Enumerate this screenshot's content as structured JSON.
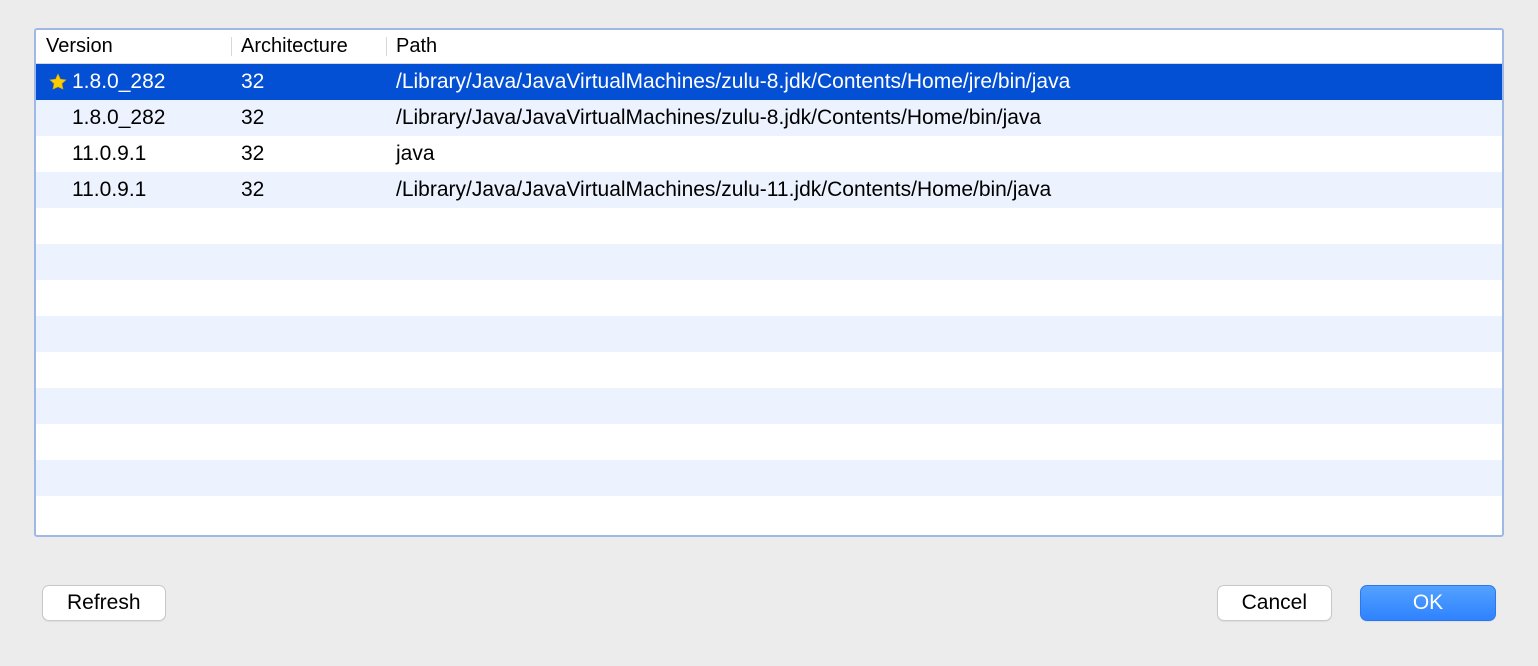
{
  "columns": {
    "version": "Version",
    "architecture": "Architecture",
    "path": "Path"
  },
  "rows": [
    {
      "starred": true,
      "version": "1.8.0_282",
      "arch": "32",
      "path": "/Library/Java/JavaVirtualMachines/zulu-8.jdk/Contents/Home/jre/bin/java",
      "selected": true
    },
    {
      "starred": false,
      "version": "1.8.0_282",
      "arch": "32",
      "path": "/Library/Java/JavaVirtualMachines/zulu-8.jdk/Contents/Home/bin/java",
      "selected": false
    },
    {
      "starred": false,
      "version": "11.0.9.1",
      "arch": "32",
      "path": "java",
      "selected": false
    },
    {
      "starred": false,
      "version": "11.0.9.1",
      "arch": "32",
      "path": "/Library/Java/JavaVirtualMachines/zulu-11.jdk/Contents/Home/bin/java",
      "selected": false
    }
  ],
  "filler_rows": 9,
  "buttons": {
    "refresh": "Refresh",
    "cancel": "Cancel",
    "ok": "OK"
  }
}
